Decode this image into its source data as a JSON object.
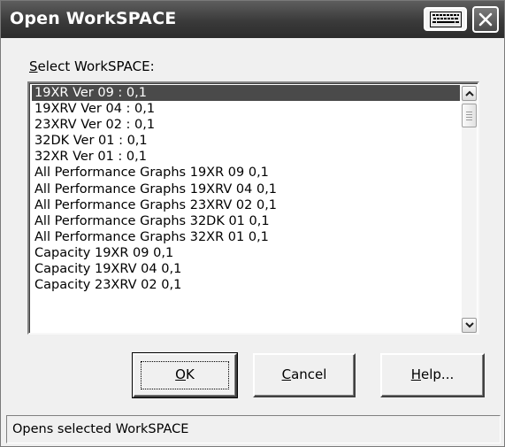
{
  "window": {
    "title": "Open WorkSPACE"
  },
  "select_label": {
    "mnemonic": "S",
    "rest": "elect WorkSPACE:"
  },
  "workspace_list": {
    "selected_index": 0,
    "items": [
      "19XR Ver 09 : 0,1",
      "19XRV Ver 04 : 0,1",
      "23XRV Ver 02 : 0,1",
      "32DK Ver 01 : 0,1",
      "32XR Ver 01 : 0,1",
      "All Performance Graphs 19XR 09 0,1",
      "All Performance Graphs 19XRV 04 0,1",
      "All Performance Graphs 23XRV 02 0,1",
      "All Performance Graphs 32DK 01 0,1",
      "All Performance Graphs 32XR 01 0,1",
      "Capacity 19XR 09 0,1",
      "Capacity 19XRV 04 0,1",
      "Capacity 23XRV 02 0,1"
    ]
  },
  "buttons": {
    "ok": {
      "mnemonic": "O",
      "rest": "K"
    },
    "cancel": {
      "mnemonic": "C",
      "rest": "ancel"
    },
    "help": {
      "mnemonic": "H",
      "rest": "elp..."
    }
  },
  "status": {
    "text": "Opens selected WorkSPACE"
  },
  "icons": {
    "keyboard": "keyboard-icon",
    "close": "close-icon",
    "scroll_up": "chevron-up-icon",
    "scroll_down": "chevron-down-icon"
  },
  "colors": {
    "titlebar": "#3a3a3a",
    "selection": "#4a4a4a",
    "dialog_face": "#f0f0f0"
  }
}
